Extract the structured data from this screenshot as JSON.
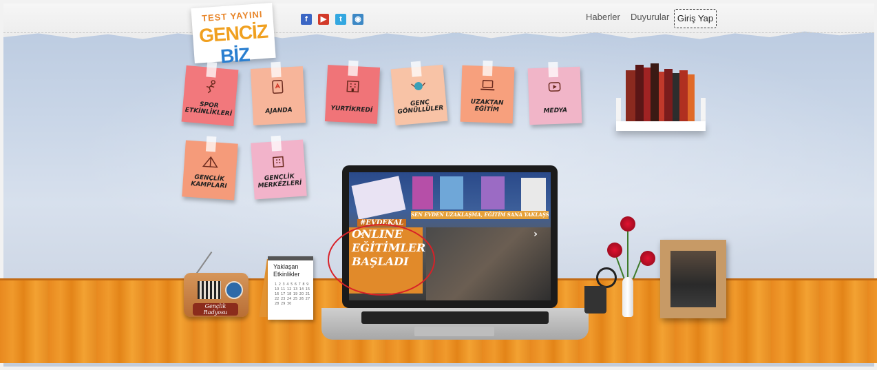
{
  "logo": {
    "top_text": "TEST YAYINI",
    "brand_a": "GENCİZ",
    "brand_b": "BİZ"
  },
  "social": {
    "facebook": "f",
    "youtube": "▶",
    "twitter": "t",
    "instagram": "◉"
  },
  "nav": {
    "news": "Haberler",
    "announcements": "Duyurular",
    "login": "Giriş Yap"
  },
  "notes": [
    {
      "label": "SPOR ETKİNLİKLERİ",
      "icon": "running-figure-icon",
      "color": "#f2787c"
    },
    {
      "label": "AJANDA",
      "icon": "agenda-icon",
      "color": "#f7b59a"
    },
    {
      "label": "YURTİKREDİ",
      "icon": "building-icon",
      "color": "#f07478"
    },
    {
      "label": "GENÇ GÖNÜLLÜLER",
      "icon": "volunteer-globe-icon",
      "color": "#f8c3a6"
    },
    {
      "label": "UZAKTAN EĞİTİM",
      "icon": "laptop-icon",
      "color": "#f7a07d"
    },
    {
      "label": "MEDYA",
      "icon": "media-play-icon",
      "color": "#f1b5c8"
    },
    {
      "label": "GENÇLİK KAMPLARI",
      "icon": "tent-icon",
      "color": "#f59b7a"
    },
    {
      "label": "GENÇLİK MERKEZLERİ",
      "icon": "center-building-icon",
      "color": "#f2b3ca"
    }
  ],
  "slider": {
    "banner": "SEN EVDEN UZAKLAŞMA, EĞİTİM SANA YAKLAŞSIN",
    "hashtag": "#EVDEKAL",
    "headline": [
      "ONLINE",
      "EĞİTİMLER",
      "BAŞLADI"
    ],
    "prev": "‹",
    "next": "›"
  },
  "radio": {
    "label": "Gençlik Radyosu"
  },
  "calendar": {
    "title_line1": "Yaklaşan",
    "title_line2": "Etkinlikler",
    "dates": "1 2 3 4 5 6 7 8 9 10 11 12 13 14 15 16 17 18 19 20 21 22 23 24 25 26 27 28 29 30"
  },
  "colors": {
    "desk": "#f09a2c",
    "highlight": "#d82128"
  }
}
